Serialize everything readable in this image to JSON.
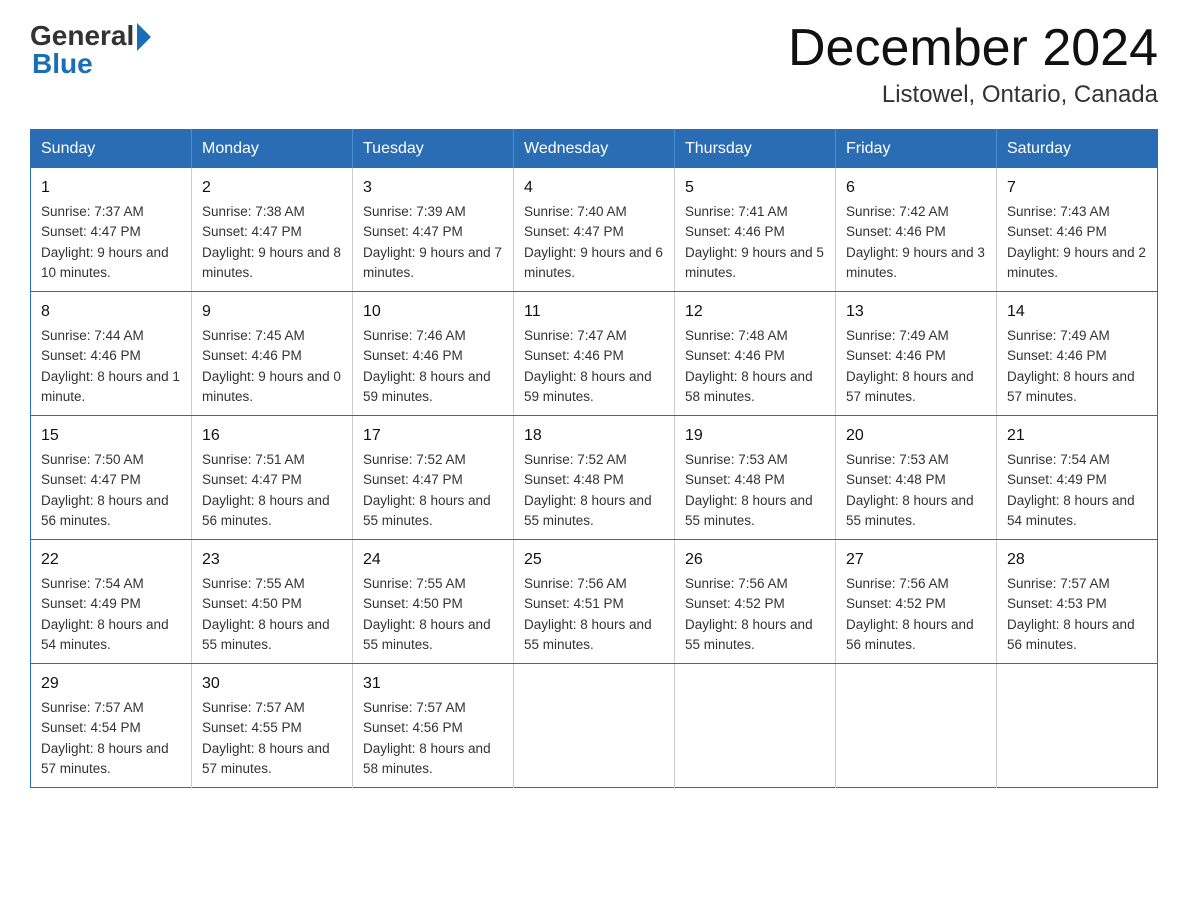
{
  "header": {
    "logo_general": "General",
    "logo_blue": "Blue",
    "month_title": "December 2024",
    "location": "Listowel, Ontario, Canada"
  },
  "calendar": {
    "days_of_week": [
      "Sunday",
      "Monday",
      "Tuesday",
      "Wednesday",
      "Thursday",
      "Friday",
      "Saturday"
    ],
    "weeks": [
      [
        {
          "day": "1",
          "sunrise": "7:37 AM",
          "sunset": "4:47 PM",
          "daylight": "9 hours and 10 minutes."
        },
        {
          "day": "2",
          "sunrise": "7:38 AM",
          "sunset": "4:47 PM",
          "daylight": "9 hours and 8 minutes."
        },
        {
          "day": "3",
          "sunrise": "7:39 AM",
          "sunset": "4:47 PM",
          "daylight": "9 hours and 7 minutes."
        },
        {
          "day": "4",
          "sunrise": "7:40 AM",
          "sunset": "4:47 PM",
          "daylight": "9 hours and 6 minutes."
        },
        {
          "day": "5",
          "sunrise": "7:41 AM",
          "sunset": "4:46 PM",
          "daylight": "9 hours and 5 minutes."
        },
        {
          "day": "6",
          "sunrise": "7:42 AM",
          "sunset": "4:46 PM",
          "daylight": "9 hours and 3 minutes."
        },
        {
          "day": "7",
          "sunrise": "7:43 AM",
          "sunset": "4:46 PM",
          "daylight": "9 hours and 2 minutes."
        }
      ],
      [
        {
          "day": "8",
          "sunrise": "7:44 AM",
          "sunset": "4:46 PM",
          "daylight": "8 hours and 1 minute."
        },
        {
          "day": "9",
          "sunrise": "7:45 AM",
          "sunset": "4:46 PM",
          "daylight": "9 hours and 0 minutes."
        },
        {
          "day": "10",
          "sunrise": "7:46 AM",
          "sunset": "4:46 PM",
          "daylight": "8 hours and 59 minutes."
        },
        {
          "day": "11",
          "sunrise": "7:47 AM",
          "sunset": "4:46 PM",
          "daylight": "8 hours and 59 minutes."
        },
        {
          "day": "12",
          "sunrise": "7:48 AM",
          "sunset": "4:46 PM",
          "daylight": "8 hours and 58 minutes."
        },
        {
          "day": "13",
          "sunrise": "7:49 AM",
          "sunset": "4:46 PM",
          "daylight": "8 hours and 57 minutes."
        },
        {
          "day": "14",
          "sunrise": "7:49 AM",
          "sunset": "4:46 PM",
          "daylight": "8 hours and 57 minutes."
        }
      ],
      [
        {
          "day": "15",
          "sunrise": "7:50 AM",
          "sunset": "4:47 PM",
          "daylight": "8 hours and 56 minutes."
        },
        {
          "day": "16",
          "sunrise": "7:51 AM",
          "sunset": "4:47 PM",
          "daylight": "8 hours and 56 minutes."
        },
        {
          "day": "17",
          "sunrise": "7:52 AM",
          "sunset": "4:47 PM",
          "daylight": "8 hours and 55 minutes."
        },
        {
          "day": "18",
          "sunrise": "7:52 AM",
          "sunset": "4:48 PM",
          "daylight": "8 hours and 55 minutes."
        },
        {
          "day": "19",
          "sunrise": "7:53 AM",
          "sunset": "4:48 PM",
          "daylight": "8 hours and 55 minutes."
        },
        {
          "day": "20",
          "sunrise": "7:53 AM",
          "sunset": "4:48 PM",
          "daylight": "8 hours and 55 minutes."
        },
        {
          "day": "21",
          "sunrise": "7:54 AM",
          "sunset": "4:49 PM",
          "daylight": "8 hours and 54 minutes."
        }
      ],
      [
        {
          "day": "22",
          "sunrise": "7:54 AM",
          "sunset": "4:49 PM",
          "daylight": "8 hours and 54 minutes."
        },
        {
          "day": "23",
          "sunrise": "7:55 AM",
          "sunset": "4:50 PM",
          "daylight": "8 hours and 55 minutes."
        },
        {
          "day": "24",
          "sunrise": "7:55 AM",
          "sunset": "4:50 PM",
          "daylight": "8 hours and 55 minutes."
        },
        {
          "day": "25",
          "sunrise": "7:56 AM",
          "sunset": "4:51 PM",
          "daylight": "8 hours and 55 minutes."
        },
        {
          "day": "26",
          "sunrise": "7:56 AM",
          "sunset": "4:52 PM",
          "daylight": "8 hours and 55 minutes."
        },
        {
          "day": "27",
          "sunrise": "7:56 AM",
          "sunset": "4:52 PM",
          "daylight": "8 hours and 56 minutes."
        },
        {
          "day": "28",
          "sunrise": "7:57 AM",
          "sunset": "4:53 PM",
          "daylight": "8 hours and 56 minutes."
        }
      ],
      [
        {
          "day": "29",
          "sunrise": "7:57 AM",
          "sunset": "4:54 PM",
          "daylight": "8 hours and 57 minutes."
        },
        {
          "day": "30",
          "sunrise": "7:57 AM",
          "sunset": "4:55 PM",
          "daylight": "8 hours and 57 minutes."
        },
        {
          "day": "31",
          "sunrise": "7:57 AM",
          "sunset": "4:56 PM",
          "daylight": "8 hours and 58 minutes."
        },
        null,
        null,
        null,
        null
      ]
    ]
  }
}
